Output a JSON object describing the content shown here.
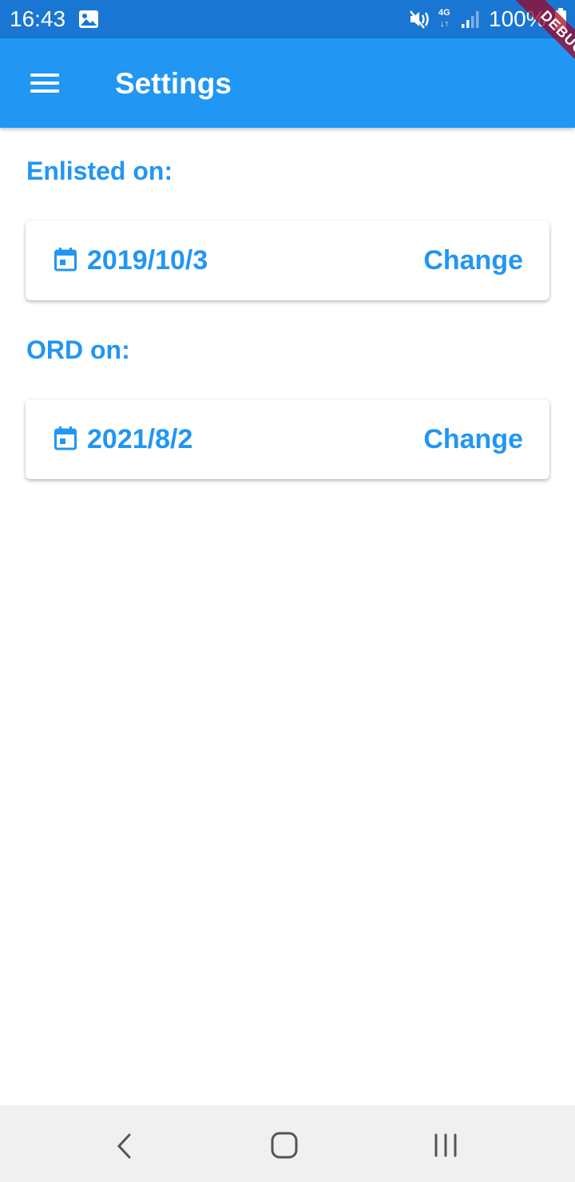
{
  "status_bar": {
    "time": "16:43",
    "network_label": "4G",
    "network_arrows": "↓↑",
    "battery": "100%",
    "icons": [
      "gallery-icon",
      "mute-icon",
      "signal-icon",
      "battery-icon"
    ]
  },
  "app_bar": {
    "title": "Settings",
    "menu_icon": "menu-icon",
    "debug_banner": "DEBUG",
    "color": "#2196f3"
  },
  "sections": [
    {
      "label": "Enlisted on:",
      "date": "2019/10/3",
      "action": "Change",
      "icon": "calendar-icon"
    },
    {
      "label": "ORD on:",
      "date": "2021/8/2",
      "action": "Change",
      "icon": "calendar-icon"
    }
  ],
  "accent_color": "#2196f3",
  "status_bar_color": "#1976d2",
  "nav_bar": {
    "icons": [
      "back-icon",
      "home-icon",
      "recents-icon"
    ]
  }
}
